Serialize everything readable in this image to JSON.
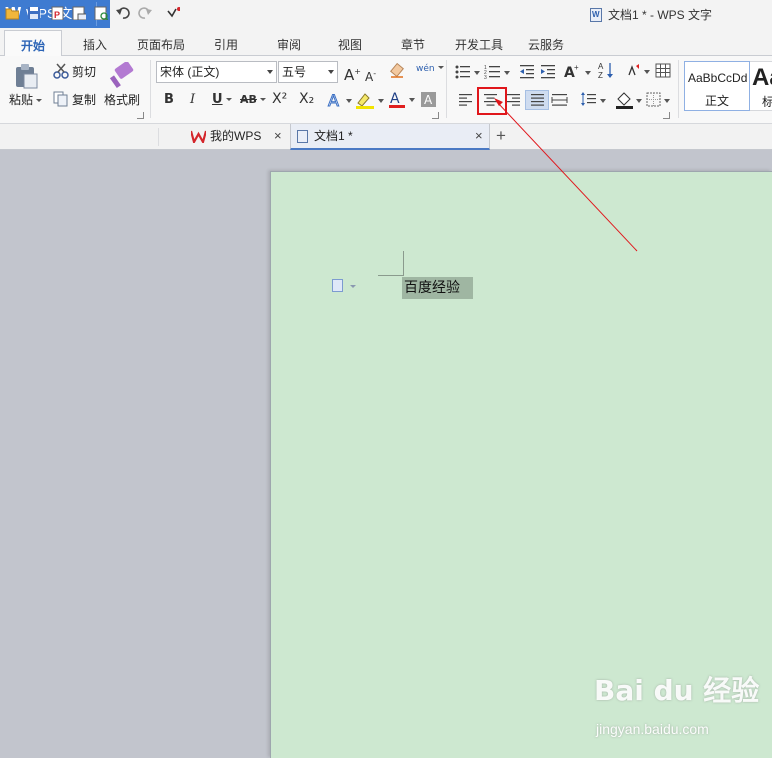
{
  "app": {
    "menu_button_label": "WPS 文字",
    "window_title": "文档1 * - WPS 文字"
  },
  "menu_tabs": [
    {
      "label": "开始",
      "active": true
    },
    {
      "label": "插入"
    },
    {
      "label": "页面布局"
    },
    {
      "label": "引用"
    },
    {
      "label": "审阅"
    },
    {
      "label": "视图"
    },
    {
      "label": "章节"
    },
    {
      "label": "开发工具"
    },
    {
      "label": "云服务"
    }
  ],
  "ribbon": {
    "clipboard": {
      "paste": "粘贴",
      "cut": "剪切",
      "copy": "复制",
      "format_painter": "格式刷"
    },
    "font": {
      "font_name": "宋体 (正文)",
      "font_size": "五号",
      "bold": "B",
      "italic": "I",
      "underline": "U",
      "strikethrough": "AB",
      "superscript": "X²",
      "subscript": "X₂",
      "grow": "A",
      "shrink": "A",
      "phonetic": "wén"
    },
    "styles": {
      "preview_text": "AaBbCcDd",
      "style_name": "正文",
      "next_preview": "Aa",
      "next_name": "标"
    }
  },
  "doc_tabs": [
    {
      "label": "我的WPS",
      "close": "×"
    },
    {
      "label": "文档1 *",
      "close": "×",
      "active": true
    }
  ],
  "new_tab": "+",
  "document": {
    "selected_text": "百度经验"
  },
  "watermark": {
    "brand": "Bai du 经验",
    "url": "jingyan.baidu.com"
  },
  "colors": {
    "accent": "#3e7bd1",
    "page_background": "#cde8d0",
    "highlight_box": "#e0161b",
    "selection": "#9fb6a2"
  }
}
